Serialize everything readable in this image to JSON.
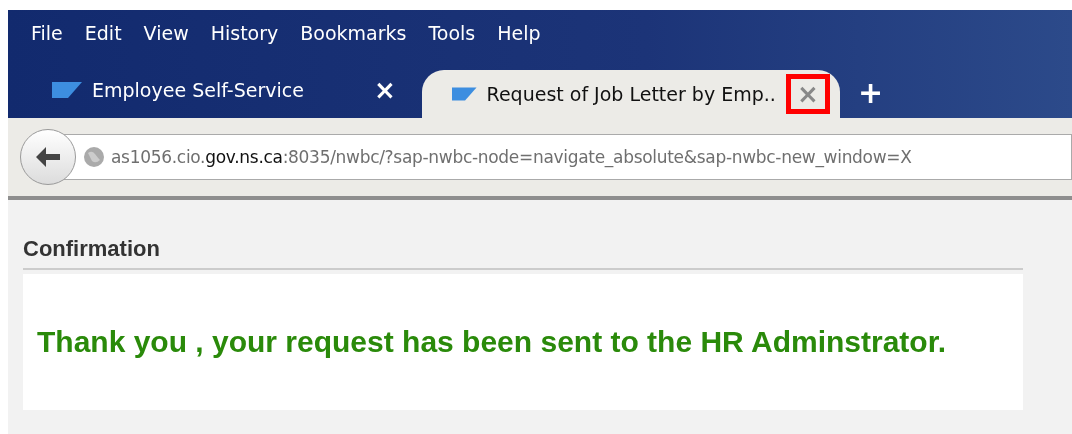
{
  "menu": [
    "File",
    "Edit",
    "View",
    "History",
    "Bookmarks",
    "Tools",
    "Help"
  ],
  "tabs": [
    {
      "title": "Employee Self-Service",
      "selected": false,
      "close": "×",
      "highlighted": false
    },
    {
      "title": "Request of Job Letter by Emp..",
      "selected": true,
      "close": "×",
      "highlighted": true
    }
  ],
  "new_tab": "+",
  "address": {
    "url": "as1056.cio.**gov.ns.ca**:8035/nwbc/?sap-nwbc-node=navigate_absolute&sap-nwbc-new_window=X"
  },
  "section": {
    "title": "Confirmation",
    "message": "Thank you , your request has been sent to the HR Adminstrator."
  }
}
